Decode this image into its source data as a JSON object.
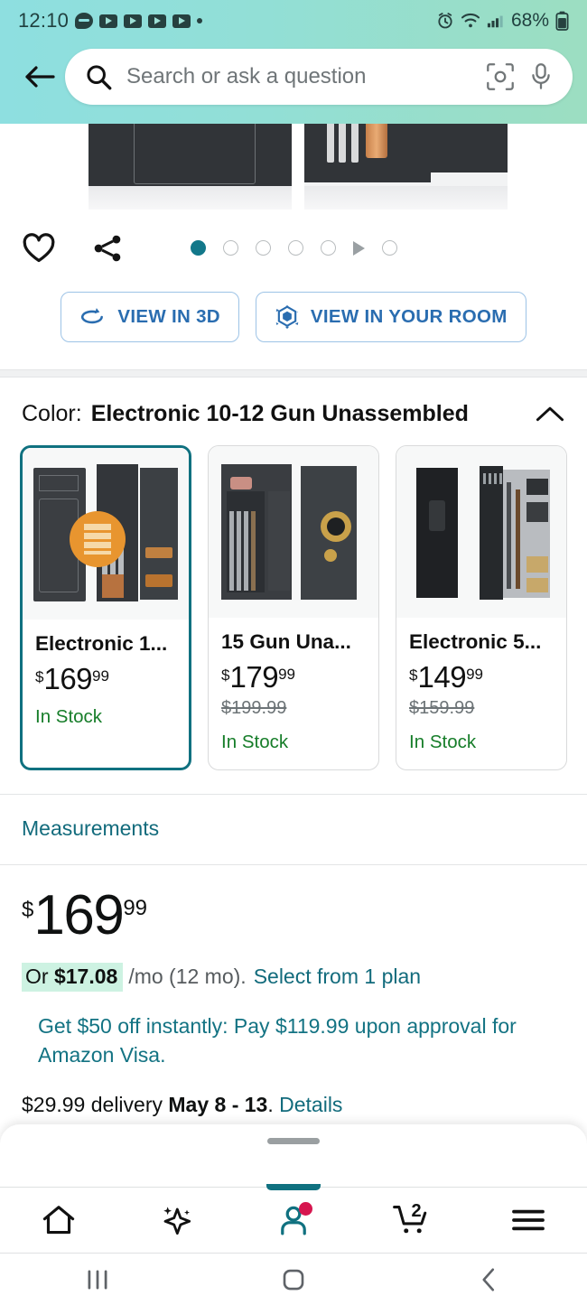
{
  "status_bar": {
    "time": "12:10",
    "battery_pct": "68%",
    "icons": [
      "chat-bubble-icon",
      "video-icon",
      "video-icon",
      "video-icon",
      "video-icon",
      "dot-icon",
      "alarm-icon",
      "wifi-icon",
      "signal-icon",
      "battery-icon"
    ]
  },
  "header": {
    "back_icon": "back-arrow-icon",
    "search_placeholder": "Search or ask a question",
    "search_value": "",
    "camera_icon": "camera-lens-icon",
    "mic_icon": "microphone-icon"
  },
  "gallery": {
    "favorite_icon": "heart-icon",
    "share_icon": "share-icon",
    "dots_total": 6,
    "active_dot": 1,
    "video_indicator": "play-triangle-icon",
    "buttons": [
      {
        "label": "VIEW IN 3D",
        "icon": "rotate-3d-icon"
      },
      {
        "label": "VIEW IN YOUR ROOM",
        "icon": "ar-cube-icon"
      }
    ]
  },
  "color_section": {
    "label": "Color:",
    "selected": "Electronic 10-12 Gun Unassembled",
    "collapse_icon": "chevron-up-icon",
    "swatches": [
      {
        "title": "Electronic 1...",
        "currency": "$",
        "whole": "169",
        "frac": "99",
        "list_price": "",
        "stock": "In Stock",
        "selected": true
      },
      {
        "title": "15 Gun Una...",
        "currency": "$",
        "whole": "179",
        "frac": "99",
        "list_price": "$199.99",
        "stock": "In Stock",
        "selected": false
      },
      {
        "title": "Electronic 5...",
        "currency": "$",
        "whole": "149",
        "frac": "99",
        "list_price": "$159.99",
        "stock": "In Stock",
        "selected": false
      }
    ]
  },
  "measurements_link": "Measurements",
  "price": {
    "currency": "$",
    "whole": "169",
    "frac": "99",
    "finance_prefix": "Or",
    "finance_amount": "$17.08",
    "finance_terms": "/mo (12 mo).",
    "finance_link": "Select from 1 plan",
    "promo": "Get $50 off instantly: Pay $119.99 upon approval for Amazon Visa.",
    "delivery_cost": "$29.99 delivery",
    "delivery_date": "May 8 - 13",
    "delivery_suffix": ".",
    "delivery_link": "Details"
  },
  "tabbar": {
    "items": [
      {
        "name": "home",
        "icon": "home-icon",
        "active": false
      },
      {
        "name": "rufus",
        "icon": "sparkle-icon",
        "active": false
      },
      {
        "name": "account",
        "icon": "person-icon",
        "active": true,
        "badge": "dot"
      },
      {
        "name": "cart",
        "icon": "cart-icon",
        "active": false,
        "badge_count": "2"
      },
      {
        "name": "menu",
        "icon": "hamburger-icon",
        "active": false
      }
    ]
  },
  "system_nav": {
    "recents_icon": "recents-icon",
    "home_icon": "home-square-icon",
    "back_icon": "back-chevron-icon"
  },
  "colors": {
    "header_gradient_start": "#8edfe0",
    "header_gradient_end": "#9cdec1",
    "teal_accent": "#107180",
    "link_teal": "#126b7c",
    "button_blue": "#2a6db0",
    "stock_green": "#167d29",
    "badge_pink": "#d6164f",
    "finance_highlight": "#cdf2e2"
  }
}
